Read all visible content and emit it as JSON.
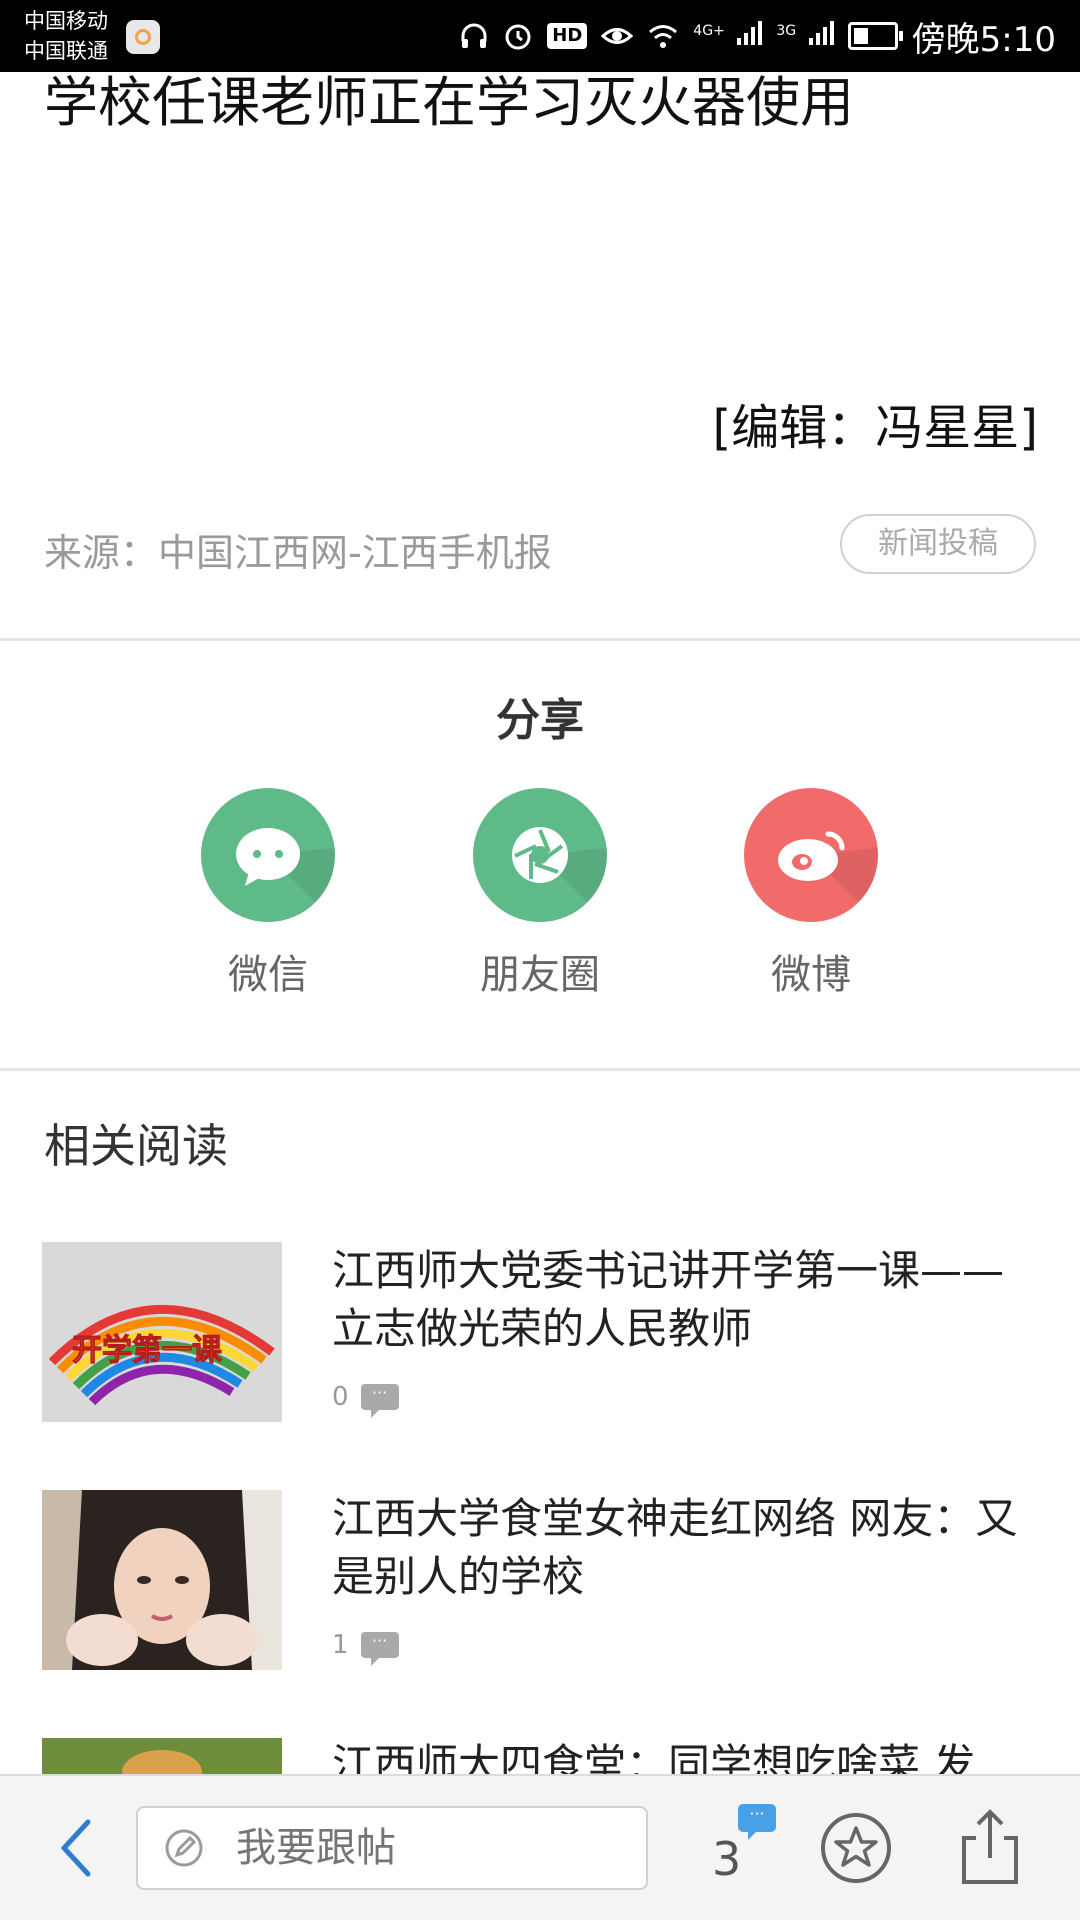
{
  "status_bar": {
    "carrier1": "中国移动",
    "carrier2": "中国联通",
    "hd": "HD",
    "net1": "4G+",
    "net2": "3G",
    "time": "傍晚5:10"
  },
  "article": {
    "title": "学校任课老师正在学习灭火器使用",
    "editor": "[编辑：冯星星]",
    "source": "来源：中国江西网-江西手机报",
    "submit_news": "新闻投稿"
  },
  "share": {
    "title": "分享",
    "items": [
      {
        "label": "微信",
        "icon": "wechat-icon",
        "color": "#5fba8a"
      },
      {
        "label": "朋友圈",
        "icon": "moments-icon",
        "color": "#5fba8a"
      },
      {
        "label": "微博",
        "icon": "weibo-icon",
        "color": "#f26b6b"
      }
    ]
  },
  "related": {
    "title": "相关阅读",
    "items": [
      {
        "title": "江西师大党委书记讲开学第一课——立志做光荣的人民教师",
        "comments": "0",
        "thumb_text": "开学第一课"
      },
      {
        "title": "江西大学食堂女神走红网络 网友：又是别人的学校",
        "comments": "1"
      },
      {
        "title": "江西师大四食堂：同学想吃啥菜 发"
      }
    ]
  },
  "bottom_bar": {
    "reply_placeholder": "我要跟帖",
    "comment_count": "3",
    "colors": {
      "accent": "#48a1e6"
    }
  }
}
